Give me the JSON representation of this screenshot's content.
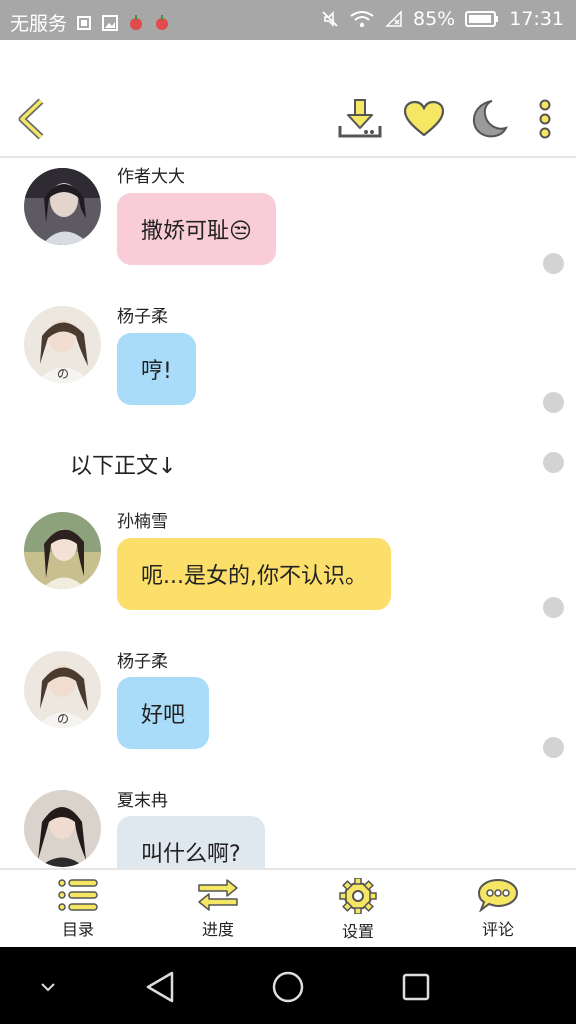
{
  "status": {
    "carrier": "无服务",
    "battery": "85%",
    "time": "17:31"
  },
  "toolbar": {
    "back_icon": "chevron-left-icon",
    "download_icon": "download-icon",
    "favorite_icon": "heart-icon",
    "night_icon": "moon-icon",
    "more_icon": "more-vertical-icon",
    "accent": "#f5e663"
  },
  "messages": [
    {
      "sender": "作者大大",
      "text": "撒娇可耻😒",
      "bubble_color": "#f9cdd8"
    },
    {
      "sender": "杨子柔",
      "text": "哼!",
      "bubble_color": "#a9dcf8"
    },
    {
      "narration": "以下正文↓"
    },
    {
      "sender": "孙楠雪",
      "text": "呃...是女的,你不认识。",
      "bubble_color": "#fbdf6a"
    },
    {
      "sender": "杨子柔",
      "text": "好吧",
      "bubble_color": "#a9dcf8"
    },
    {
      "sender": "夏末冉",
      "text": "叫什么啊?",
      "bubble_color": "#dfe7ef"
    }
  ],
  "bottom_nav": {
    "catalog": "目录",
    "progress": "进度",
    "settings": "设置",
    "comments": "评论"
  }
}
